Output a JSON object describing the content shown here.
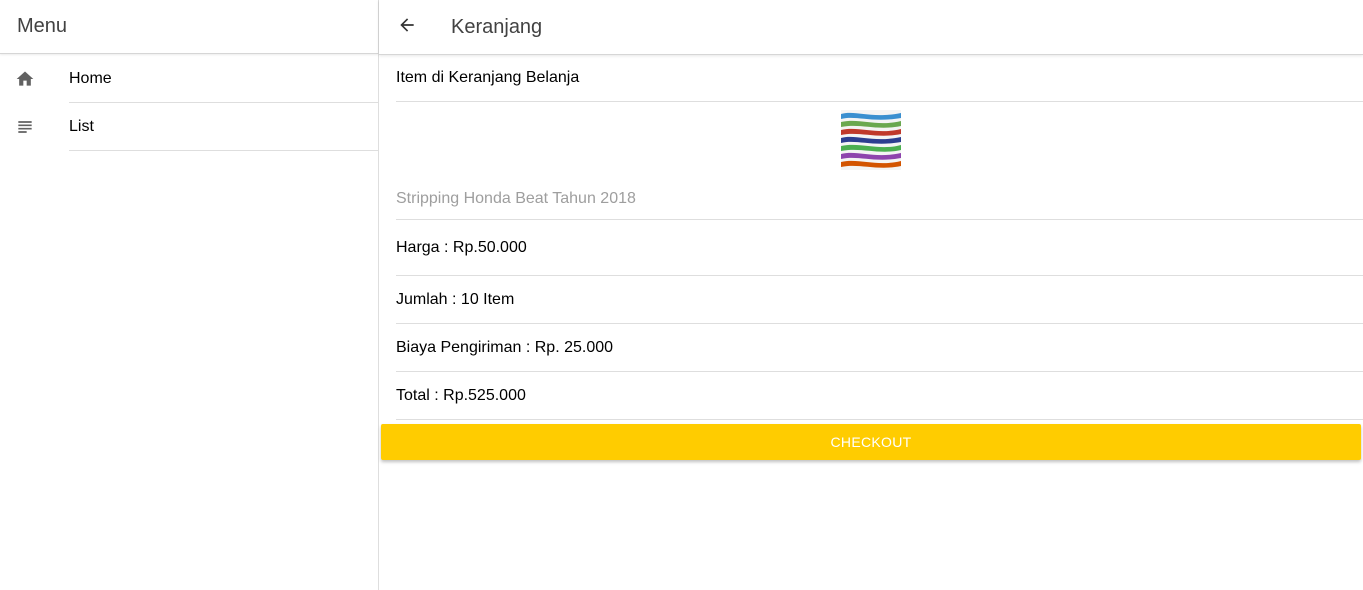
{
  "sidebar": {
    "title": "Menu",
    "items": [
      {
        "label": "Home",
        "icon": "home-icon"
      },
      {
        "label": "List",
        "icon": "list-icon"
      }
    ]
  },
  "header": {
    "back_icon": "arrow-left-icon",
    "title": "Keranjang"
  },
  "cart": {
    "heading": "Item di Keranjang Belanja",
    "product_name": "Stripping Honda Beat Tahun 2018",
    "price": "Harga : Rp.50.000",
    "quantity": "Jumlah : 10 Item",
    "shipping": "Biaya Pengiriman : Rp. 25.000",
    "total": "Total : Rp.525.000"
  },
  "actions": {
    "checkout_label": "CHECKOUT"
  },
  "colors": {
    "accent": "#ffcc00",
    "muted_text": "#9e9e9e",
    "divider": "#dedede"
  }
}
